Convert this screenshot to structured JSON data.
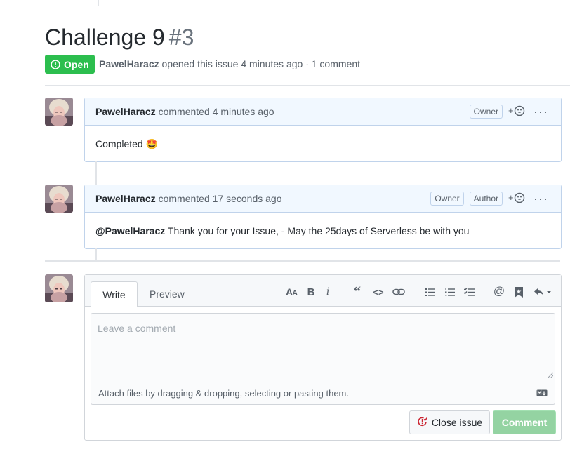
{
  "issue": {
    "title": "Challenge 9",
    "number": "#3",
    "state": "Open",
    "author": "PawelHaracz",
    "opened_text": "opened this issue 4 minutes ago · 1 comment"
  },
  "comments": [
    {
      "author": "PawelHaracz",
      "action": "commented 4 minutes ago",
      "labels": [
        "Owner"
      ],
      "body": "Completed",
      "emoji": "🤩"
    },
    {
      "author": "PawelHaracz",
      "action": "commented 17 seconds ago",
      "labels": [
        "Owner",
        "Author"
      ],
      "mention": "@PawelHaracz",
      "body": "Thank you for your Issue, - May the 25days of Serverless be with you"
    }
  ],
  "reaction_icon": "smiley-add-icon",
  "more_icon": "kebab-horizontal-icon",
  "composer": {
    "tabs": [
      "Write",
      "Preview"
    ],
    "placeholder": "Leave a comment",
    "attach_text": "Attach files by dragging & dropping, selecting or pasting them.",
    "toolbar_icons": [
      "text-size-icon",
      "bold-icon",
      "italic-icon",
      "quote-icon",
      "code-icon",
      "link-icon",
      "unordered-list-icon",
      "ordered-list-icon",
      "task-list-icon",
      "mention-icon",
      "saved-reply-icon",
      "reply-dropdown-icon"
    ],
    "close_label": "Close issue",
    "comment_label": "Comment"
  },
  "colors": {
    "open_green": "#2cbe4e",
    "comment_button_disabled": "#94d3a2",
    "header_blue_bg": "#f1f8ff",
    "header_blue_border": "#c0d3eb",
    "close_icon_red": "#cb2431"
  }
}
